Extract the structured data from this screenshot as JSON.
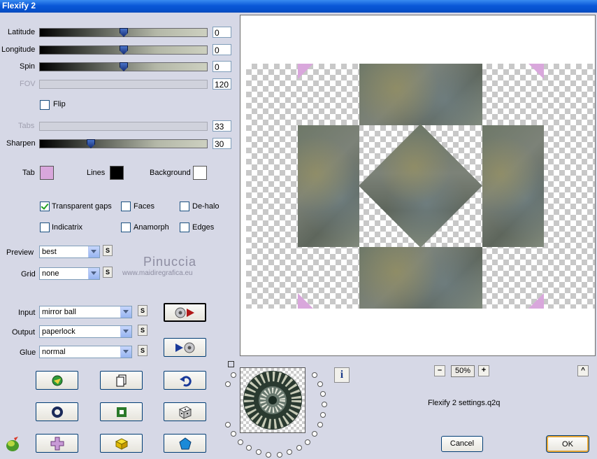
{
  "window": {
    "title": "Flexify 2"
  },
  "sliders": [
    {
      "label": "Latitude",
      "value": "0",
      "enabled": true,
      "level": 0.5
    },
    {
      "label": "Longitude",
      "value": "0",
      "enabled": true,
      "level": 0.5
    },
    {
      "label": "Spin",
      "value": "0",
      "enabled": true,
      "level": 0.5
    },
    {
      "label": "FOV",
      "value": "120",
      "enabled": false,
      "level": 0
    },
    {
      "label": "Tabs",
      "value": "33",
      "enabled": false,
      "level": 0
    },
    {
      "label": "Sharpen",
      "value": "30",
      "enabled": true,
      "level": 0.3
    }
  ],
  "flip": {
    "label": "Flip",
    "checked": false
  },
  "colors": {
    "tab": {
      "label": "Tab",
      "color": "#d9a7dc"
    },
    "lines": {
      "label": "Lines",
      "color": "#000000"
    },
    "background": {
      "label": "Background",
      "color": "#ffffff"
    }
  },
  "options": [
    {
      "label": "Transparent gaps",
      "checked": true
    },
    {
      "label": "Faces",
      "checked": false
    },
    {
      "label": "De-halo",
      "checked": false
    },
    {
      "label": "Indicatrix",
      "checked": false
    },
    {
      "label": "Anamorph",
      "checked": false
    },
    {
      "label": "Edges",
      "checked": false
    }
  ],
  "preview_select": {
    "label": "Preview",
    "value": "best",
    "s_label": "S"
  },
  "grid_select": {
    "label": "Grid",
    "value": "none",
    "s_label": "S"
  },
  "watermark": {
    "line1": "Pinuccia",
    "line2": "www.maidiregrafica.eu"
  },
  "input_select": {
    "label": "Input",
    "value": "mirror ball",
    "s_label": "S"
  },
  "output_select": {
    "label": "Output",
    "value": "paperlock",
    "s_label": "S"
  },
  "glue_select": {
    "label": "Glue",
    "value": "normal",
    "s_label": "S"
  },
  "zoom": {
    "minus": "–",
    "value": "50%",
    "plus": "+"
  },
  "info_label": "i",
  "collapse_label": "^",
  "settings_file": "Flexify 2 settings.q2q",
  "buttons": {
    "cancel": "Cancel",
    "ok": "OK"
  },
  "icons": [
    "convert-play-icon",
    "convert-back-icon",
    "random-icon",
    "copy-icon",
    "undo-icon",
    "ring-icon",
    "square-icon",
    "dice-icon",
    "cross-icon",
    "cube-icon",
    "pentagon-icon",
    "app-logo-icon"
  ]
}
